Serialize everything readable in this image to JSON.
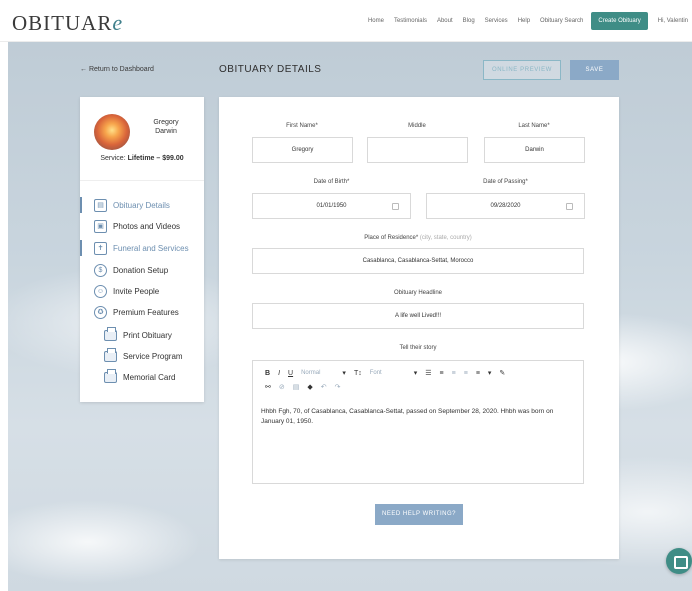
{
  "header": {
    "logo": "OBITUAR",
    "logo_e": "e",
    "nav": [
      "Home",
      "Testimonials",
      "About",
      "Blog",
      "Services",
      "Help",
      "Obituary Search"
    ],
    "cta": "Create Obituary",
    "greeting": "Hi, Valentin"
  },
  "topbar": {
    "return_link": "← Return to Dashboard",
    "title": "OBITUARY DETAILS",
    "preview_label": "ONLINE PREVIEW",
    "save_label": "SAVE"
  },
  "sidebar": {
    "name_first": "Gregory",
    "name_last": "Darwin",
    "service_prefix": "Service: ",
    "service_value": "Lifetime – $99.00",
    "items": [
      {
        "label": "Obituary Details",
        "icon": "document-icon",
        "glyph": "▤"
      },
      {
        "label": "Photos and Videos",
        "icon": "photos-icon",
        "glyph": "▣"
      },
      {
        "label": "Funeral and Services",
        "icon": "cross-icon",
        "glyph": "✝"
      },
      {
        "label": "Donation Setup",
        "icon": "dollar-icon",
        "glyph": "$"
      },
      {
        "label": "Invite People",
        "icon": "person-icon",
        "glyph": "☺"
      },
      {
        "label": "Premium Features",
        "icon": "award-icon",
        "glyph": "✪"
      }
    ],
    "subitems": [
      {
        "label": "Print Obituary",
        "icon": "printer-icon"
      },
      {
        "label": "Service Program",
        "icon": "printer-icon"
      },
      {
        "label": "Memorial Card",
        "icon": "printer-icon"
      }
    ]
  },
  "form": {
    "first_name_label": "First Name*",
    "middle_label": "Middle",
    "last_name_label": "Last Name*",
    "first_name_value": "Gregory",
    "middle_value": "",
    "last_name_value": "Darwin",
    "dob_label": "Date of Birth*",
    "dop_label": "Date of Passing*",
    "dob_value": "01/01/1950",
    "dop_value": "09/28/2020",
    "residence_label": "Place of Residence*",
    "residence_hint": " (city, state, country)",
    "residence_value": "Casablanca, Casablanca-Settat, Morocco",
    "headline_label": "Obituary Headline",
    "headline_value": "A life well Lived!!!",
    "story_label": "Tell their story",
    "story_text": "Hhbh Fgh, 70, of Casablanca, Casablanca-Settat, passed on September 28, 2020. Hhbh was born on January 01, 1950.",
    "toolbar": {
      "bold": "B",
      "italic": "I",
      "underline": "U",
      "style": "Normal",
      "size": "T↕",
      "font": "Font",
      "caret": "▾"
    },
    "help_button": "NEED HELP WRITING?"
  }
}
